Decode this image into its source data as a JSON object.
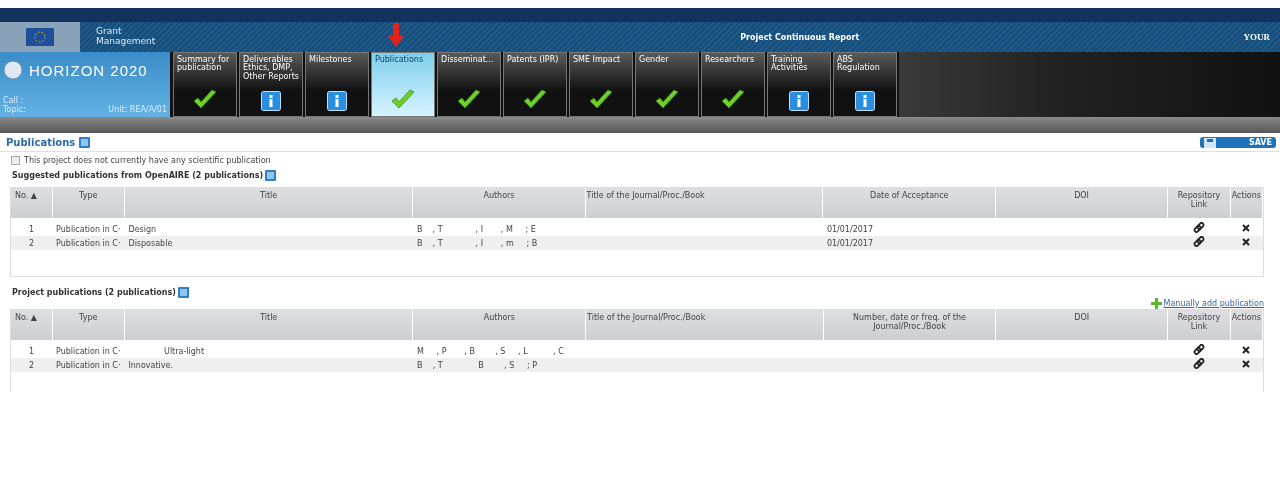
{
  "header": {
    "brand": "Grant Management",
    "title": "Project Continuous Report",
    "logo_text": "YOUR",
    "program": "HORIZON 2020",
    "call": "Call :",
    "topic": "Topic:",
    "unit": "Unit: REA/A/01"
  },
  "tabs": [
    {
      "label": "Summary for publication",
      "kind": "done",
      "selected": false
    },
    {
      "label": "Deliverables Ethics, DMP, Other Reports",
      "kind": "info",
      "selected": false
    },
    {
      "label": "Milestones",
      "kind": "info",
      "selected": false
    },
    {
      "label": "Publications",
      "kind": "done",
      "selected": true
    },
    {
      "label": "Disseminat...",
      "kind": "done",
      "selected": false
    },
    {
      "label": "Patents (IPR)",
      "kind": "done",
      "selected": false
    },
    {
      "label": "SME Impact",
      "kind": "done",
      "selected": false
    },
    {
      "label": "Gender",
      "kind": "done",
      "selected": false
    },
    {
      "label": "Researchers",
      "kind": "done",
      "selected": false
    },
    {
      "label": "Training Activities",
      "kind": "info",
      "selected": false
    },
    {
      "label": "ABS Regulation",
      "kind": "info",
      "selected": false
    }
  ],
  "page": {
    "title": "Publications",
    "save": "SAVE",
    "no_publication": {
      "label": "This project does not currently have any scientific publication",
      "checked": false
    }
  },
  "tables": [
    {
      "title": "Suggested publications from OpenAIRE (2 publications)",
      "columns": [
        "No. ▲",
        "Type",
        "Title",
        "Authors",
        "Title of the Journal/Proc./Book",
        "Date of Acceptance",
        "DOI",
        "Repository Link",
        "Actions"
      ],
      "rows": [
        [
          "1",
          "Publication in C·",
          "Design",
          "B    , T             , I       , M     ; E",
          "",
          "01/01/2017",
          ""
        ],
        [
          "2",
          "Publication in C·",
          "Disposable",
          "B    , T             , I       , m     ; B",
          "",
          "01/01/2017",
          ""
        ]
      ]
    },
    {
      "title": "Project publications (2 publications)",
      "add_link": "Manually add publication",
      "columns": [
        "No. ▲",
        "Type",
        "Title",
        "Authors",
        "Title of the Journal/Proc./Book",
        "Number, date or freq. of the Journal/Proc./Book",
        "DOI",
        "Repository Link",
        "Actions"
      ],
      "rows": [
        [
          "1",
          "Publication in C·",
          "              Ultra-light",
          "M     , P       , B        , S     , L          , C",
          "",
          "",
          ""
        ],
        [
          "2",
          "Publication in C·",
          "Innovative.",
          "B    , T              B        , S     ; P",
          "",
          "",
          ""
        ]
      ]
    }
  ]
}
